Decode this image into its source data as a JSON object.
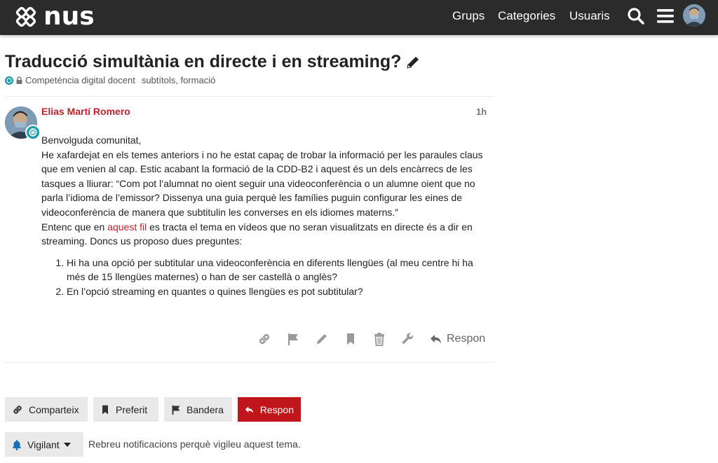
{
  "header": {
    "logo_text": "nus",
    "nav": [
      "Grups",
      "Categories",
      "Usuaris"
    ],
    "icons": [
      "search-icon",
      "hamburger-menu-icon"
    ]
  },
  "topic": {
    "title": "Traducció simultània en directe i en streaming?",
    "category": "Competència digital docent",
    "tags": "subtítols, formació"
  },
  "post": {
    "author": "Elias Martí Romero",
    "time": "1h",
    "greeting": "Benvolguda comunitat,",
    "para1": "He xafardejat en els temes anteriors i no he estat capaç de trobar la informació per les paraules claus que em venien al cap. Estic acabant la formació de la CDD-B2 i aquest és un dels encàrrecs de les tasques a lliurar: “Com pot l’alumnat no oient seguir una videoconferència o un alumne oient que no parla l’idioma de l’emissor? Dissenya una guia perquè les famílies puguin configurar les eines de videoconferència de manera que subtitulin les converses en els idiomes materns.”",
    "para2_before": "Entenc que en ",
    "para2_link": "aquest fil",
    "para2_after": " es tracta el tema en vídeos que no seran visualitzats en directe és a dir en streaming. Doncs us proposo dues preguntes:",
    "questions": [
      "Hi ha una opció per subtitular una videoconferència en diferents llengües (al meu centre hi ha més de 15 llengües maternes) o han de ser castellà o anglès?",
      "En l’opció streaming en quantes o quines llengües es pot subtitular?"
    ],
    "reply_label": "Respon"
  },
  "footer": {
    "share": "Comparteix",
    "bookmark": "Preferit",
    "flag": "Bandera",
    "reply": "Respon",
    "watching": "Vigilant",
    "notification_text": "Rebreu notificacions perquè vigileu aquest tema."
  },
  "colors": {
    "header_bg": "#2b2b2b",
    "accent": "#c0151b",
    "author": "#c0222b",
    "badge": "#1b9aaa"
  }
}
